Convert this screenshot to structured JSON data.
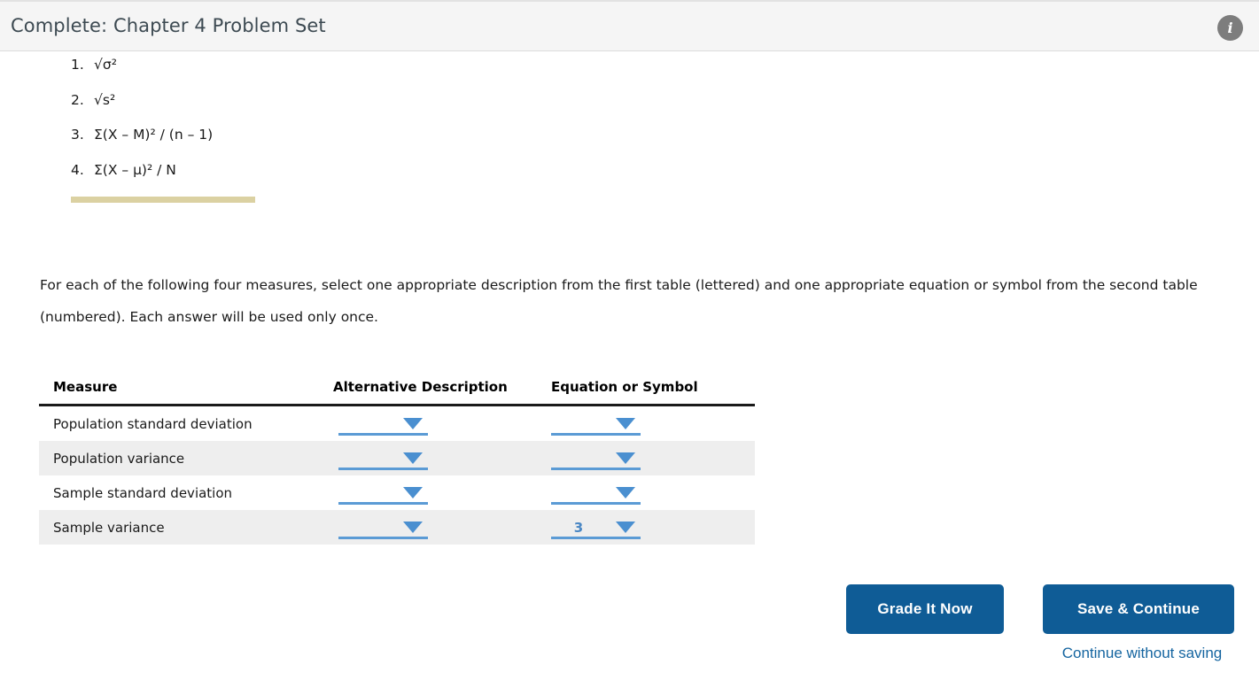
{
  "header": {
    "title": "Complete: Chapter 4 Problem Set",
    "info_icon_glyph": "i",
    "background_color": "#f5f5f5"
  },
  "equation_list": [
    {
      "num": "1.",
      "text": "√σ²"
    },
    {
      "num": "2.",
      "text": "√s²"
    },
    {
      "num": "3.",
      "text": "Σ(X – M)² / (n – 1)"
    },
    {
      "num": "4.",
      "text": "Σ(X – μ)² / N"
    }
  ],
  "divider": {
    "color": "#dbd1a2"
  },
  "instructions": {
    "text": "For each of the following four measures, select one appropriate description from the first table (lettered) and one appropriate equation or symbol from the second table (numbered). Each answer will be used only once."
  },
  "table": {
    "headers": {
      "measure": "Measure",
      "description": "Alternative Description",
      "equation": "Equation or Symbol"
    },
    "rows": [
      {
        "measure": "Population standard deviation",
        "description_value": "",
        "equation_value": ""
      },
      {
        "measure": "Population variance",
        "description_value": "",
        "equation_value": ""
      },
      {
        "measure": "Sample standard deviation",
        "description_value": "",
        "equation_value": ""
      },
      {
        "measure": "Sample variance",
        "description_value": "",
        "equation_value": "3"
      }
    ],
    "accent_color": "#5b9bd5"
  },
  "footer": {
    "grade_label": "Grade It Now",
    "save_label": "Save & Continue",
    "continue_link_label": "Continue without saving",
    "button_color": "#0f5c96",
    "link_color": "#1565a0"
  }
}
